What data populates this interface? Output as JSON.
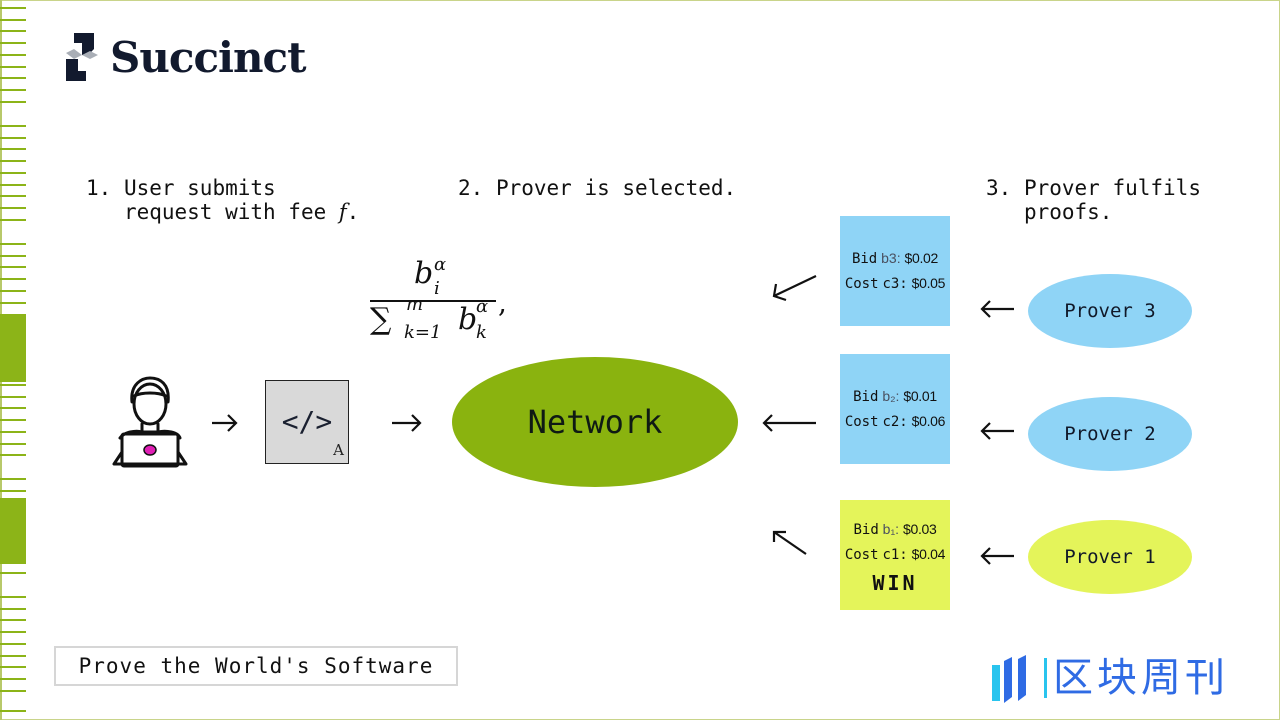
{
  "brand": {
    "logo_icon": "succinct-logo-icon",
    "name": "Succinct"
  },
  "colors": {
    "accent_green": "#8ab30f",
    "prover_blue": "#8fd4f6",
    "winner_yellow": "#e4f45a",
    "bid_blue": "#8fd4f6",
    "code_grey": "#d9d9d9",
    "watermark_blue": "#2f6be4"
  },
  "steps": [
    {
      "number": "1.",
      "line1": "User submits",
      "line2": "request with fee ",
      "math_var": "f",
      "suffix": "."
    },
    {
      "number": "2.",
      "line1": "Prover is selected."
    },
    {
      "number": "3.",
      "line1": "Prover fulfils",
      "line2": "proofs."
    }
  ],
  "formula": {
    "numerator": "b",
    "numerator_sup": "α",
    "numerator_sub": "i",
    "denominator": "∑",
    "denominator_sup": "m",
    "denominator_sub": "k=1",
    "denominator_term": "b",
    "denominator_term_sup": "α",
    "denominator_term_sub": "k",
    "trailing": ","
  },
  "flow": {
    "user_icon": "user-laptop-icon",
    "code_box": {
      "symbol": "</>",
      "corner_label": "A"
    },
    "network_label": "Network"
  },
  "bids": [
    {
      "prover": "Prover 3",
      "bid_label": "Bid",
      "bid_var": "b3:",
      "bid_value": "$0.02",
      "cost_label": "Cost",
      "cost_var": "c3:",
      "cost_value": "$0.05",
      "winner": false
    },
    {
      "prover": "Prover 2",
      "bid_label": "Bid",
      "bid_var": "b₂:",
      "bid_value": "$0.01",
      "cost_label": "Cost",
      "cost_var": "c2:",
      "cost_value": "$0.06",
      "winner": false
    },
    {
      "prover": "Prover 1",
      "bid_label": "Bid",
      "bid_var": "b₁:",
      "bid_value": "$0.03",
      "cost_label": "Cost",
      "cost_var": "c1:",
      "cost_value": "$0.04",
      "winner": true,
      "badge": "WIN"
    }
  ],
  "provers": [
    {
      "label": "Prover 3",
      "color": "#8fd4f6"
    },
    {
      "label": "Prover 2",
      "color": "#8fd4f6"
    },
    {
      "label": "Prover 1",
      "color": "#e4f45a"
    }
  ],
  "tagline": "Prove the World's Software",
  "watermark": {
    "icon": "qukuai-weekly-logo-icon",
    "text": "区块周刊"
  }
}
